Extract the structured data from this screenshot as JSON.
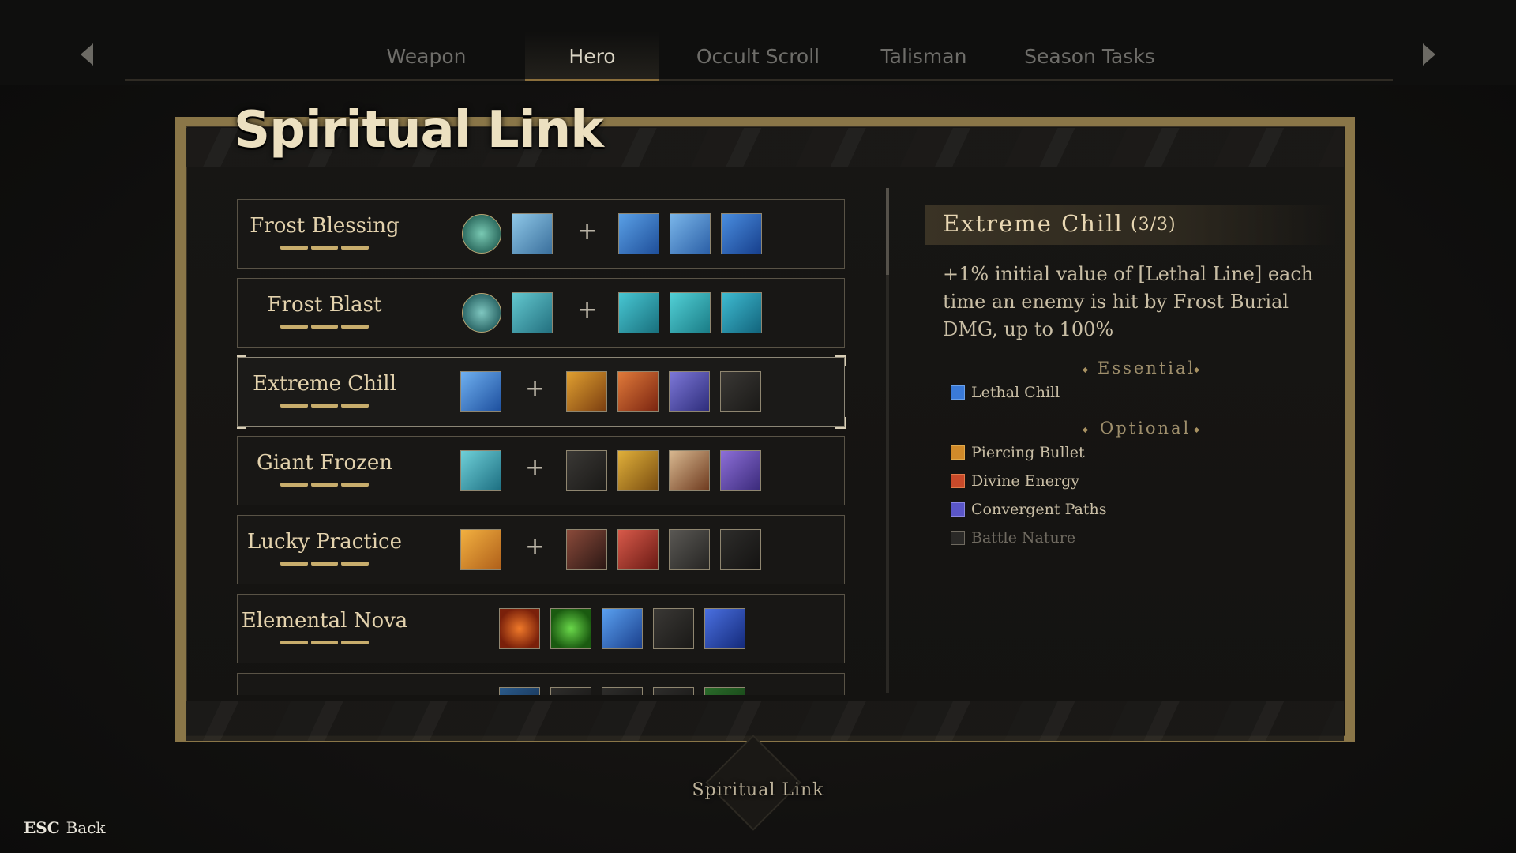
{
  "tabs": [
    "Weapon",
    "Hero",
    "Occult Scroll",
    "Talisman",
    "Season Tasks"
  ],
  "active_tab": "Hero",
  "panel": {
    "title": "Spiritual Link"
  },
  "links": [
    {
      "name": "Frost Blessing",
      "pips": 3,
      "round_icon": "frost-orb-icon",
      "core_icon": "frost-burst-icon",
      "components": [
        "ice-spirit-icon",
        "frost-wisp-icon",
        "ice-shards-icon"
      ]
    },
    {
      "name": "Frost Blast",
      "pips": 3,
      "round_icon": "frost-orb-icon",
      "core_icon": "frost-nova-icon",
      "components": [
        "frost-wave-icon",
        "frost-swirl-icon",
        "frost-vortex-icon"
      ]
    },
    {
      "name": "Extreme Chill",
      "pips": 3,
      "core_icon": "lethal-chill-icon",
      "components": [
        "piercing-bullet-icon",
        "divine-energy-icon",
        "convergent-paths-icon",
        "battle-nature-icon"
      ]
    },
    {
      "name": "Giant Frozen",
      "pips": 3,
      "core_icon": "giant-frozen-icon",
      "components": [
        "tombstone-icon",
        "gold-coins-icon",
        "spiral-shell-icon",
        "crystal-orb-icon"
      ]
    },
    {
      "name": "Lucky Practice",
      "pips": 3,
      "core_icon": "lucky-practice-icon",
      "components": [
        "warrior-figure-icon",
        "heart-charm-icon",
        "stone-disc-icon",
        "shadow-mask-icon"
      ]
    },
    {
      "name": "Elemental Nova",
      "pips": 3,
      "components": [
        "fire-ring-icon",
        "nature-ring-icon",
        "frost-crystal-icon",
        "dark-rune-icon",
        "lightning-chain-icon"
      ]
    }
  ],
  "detail": {
    "title": "Extreme Chill",
    "count": "(3/3)",
    "description": "+1% initial value of [Lethal Line] each time an enemy is hit by Frost Burial DMG, up to 100%",
    "essential_label": "Essential",
    "essential": [
      {
        "name": "Lethal Chill",
        "icon": "lethal-chill-icon",
        "owned": true
      }
    ],
    "optional_label": "Optional",
    "optional": [
      {
        "name": "Piercing Bullet",
        "icon": "piercing-bullet-icon",
        "owned": true
      },
      {
        "name": "Divine Energy",
        "icon": "divine-energy-icon",
        "owned": true
      },
      {
        "name": "Convergent Paths",
        "icon": "convergent-paths-icon",
        "owned": true
      },
      {
        "name": "Battle Nature",
        "icon": "battle-nature-icon",
        "owned": false
      }
    ]
  },
  "footer": {
    "center_label": "Spiritual Link",
    "esc_key": "ESC",
    "esc_label": "Back"
  },
  "colors": {
    "gold": "#c8ad6c",
    "frame": "#8a7648",
    "text": "#e3d2ad"
  }
}
